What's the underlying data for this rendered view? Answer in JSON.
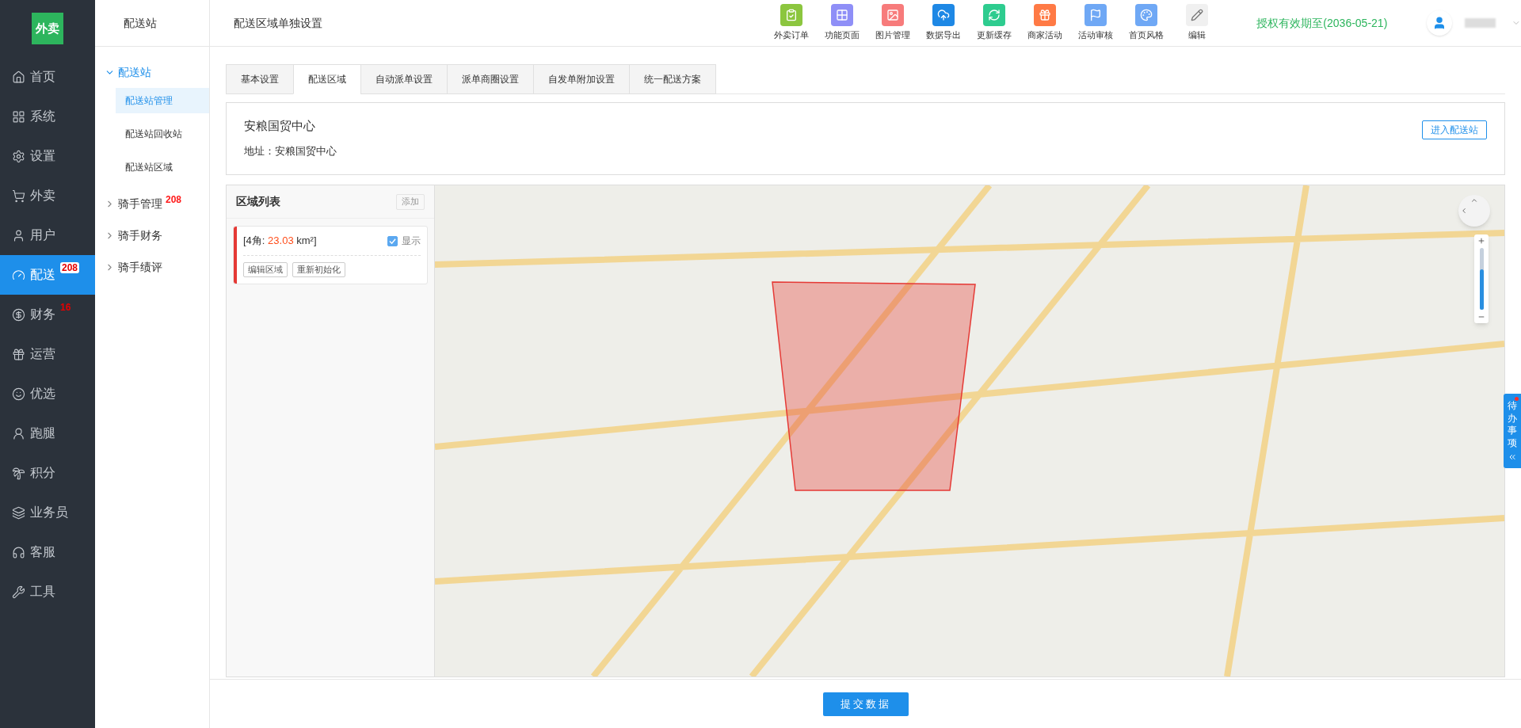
{
  "logo": {
    "text": "外卖"
  },
  "sidebar": {
    "items": [
      {
        "label": "首页",
        "selected": false
      },
      {
        "label": "系统",
        "selected": false
      },
      {
        "label": "设置",
        "selected": false
      },
      {
        "label": "外卖",
        "selected": false
      },
      {
        "label": "用户",
        "selected": false
      },
      {
        "label": "配送",
        "selected": true,
        "badge": "208"
      },
      {
        "label": "财务",
        "selected": false,
        "badge": "16"
      },
      {
        "label": "运营",
        "selected": false
      },
      {
        "label": "优选",
        "selected": false
      },
      {
        "label": "跑腿",
        "selected": false
      },
      {
        "label": "积分",
        "selected": false
      },
      {
        "label": "业务员",
        "selected": false
      },
      {
        "label": "客服",
        "selected": false
      },
      {
        "label": "工具",
        "selected": false
      }
    ]
  },
  "subnav": {
    "title": "配送站",
    "items": [
      {
        "label": "配送站",
        "expanded": true,
        "children": [
          {
            "label": "配送站管理",
            "selected": true
          },
          {
            "label": "配送站回收站",
            "selected": false
          },
          {
            "label": "配送站区域",
            "selected": false
          }
        ]
      },
      {
        "label": "骑手管理",
        "expanded": false,
        "badge": "208"
      },
      {
        "label": "骑手财务",
        "expanded": false
      },
      {
        "label": "骑手绩评",
        "expanded": false
      }
    ]
  },
  "header": {
    "title": "配送区域单独设置",
    "toolbar": [
      {
        "label": "外卖订单",
        "color": "#8cc63f"
      },
      {
        "label": "功能页面",
        "color": "#8f8ff7"
      },
      {
        "label": "图片管理",
        "color": "#f77b7b"
      },
      {
        "label": "数据导出",
        "color": "#1e88e5"
      },
      {
        "label": "更新缓存",
        "color": "#2ecc8f"
      },
      {
        "label": "商家活动",
        "color": "#ff7a45"
      },
      {
        "label": "活动审核",
        "color": "#6fa8f5"
      },
      {
        "label": "首页风格",
        "color": "#6fa8f5"
      },
      {
        "label": "编辑",
        "color": "#f0f0f0"
      }
    ],
    "license": "授权有效期至(2036-05-21)"
  },
  "tabs": [
    {
      "label": "基本设置",
      "selected": false
    },
    {
      "label": "配送区域",
      "selected": true
    },
    {
      "label": "自动派单设置",
      "selected": false
    },
    {
      "label": "派单商圈设置",
      "selected": false
    },
    {
      "label": "自发单附加设置",
      "selected": false
    },
    {
      "label": "统一配送方案",
      "selected": false
    }
  ],
  "station": {
    "name": "安粮国贸中心",
    "address": "地址：安粮国贸中心",
    "enter_button": "进入配送站"
  },
  "region_list": {
    "title": "区域列表",
    "add_button": "添加",
    "add_disabled": true,
    "regions": [
      {
        "summary_prefix": "[4角: ",
        "area": "23.03",
        "summary_suffix": " km²]",
        "show_label": "显示",
        "checked": true,
        "color": "#e53935",
        "buttons": [
          "编辑区域",
          "重新初始化"
        ]
      }
    ]
  },
  "map": {
    "zoom": {
      "level": 0.66
    }
  },
  "todo_tab": {
    "label": "待办事项",
    "unread": true
  },
  "submit_button": "提交数据"
}
